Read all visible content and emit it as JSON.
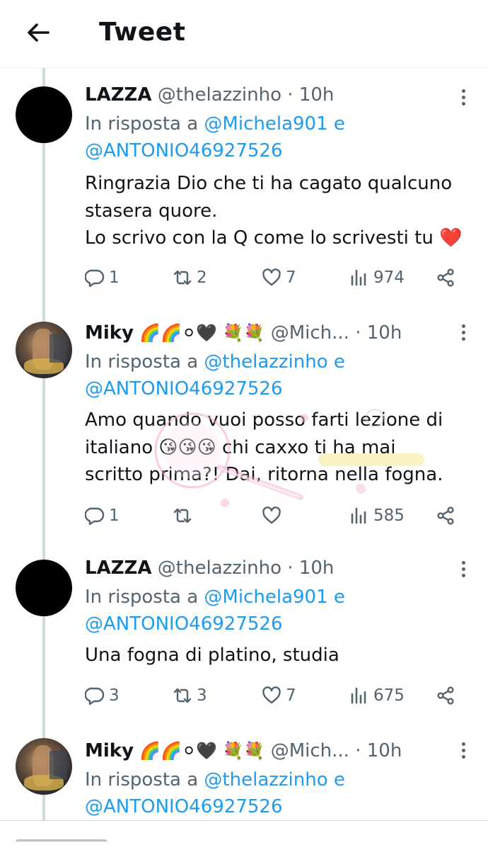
{
  "header": {
    "title": "Tweet",
    "back_icon": "arrow-left-icon"
  },
  "tweets": [
    {
      "name": "LAZZA",
      "handle": "@thelazzinho",
      "separator": "·",
      "time": "10h",
      "reply_prefix": "In risposta a",
      "reply_mention_1": "@Michela901",
      "reply_and": "e",
      "reply_mention_2": "@ANTONIO46927526",
      "lines": [
        "Ringrazia Dio che ti ha cagato qualcuno",
        "stasera quore.",
        "Lo scrivo con la Q come lo scrivesti tu ❤️"
      ],
      "replies": "1",
      "retweets": "2",
      "likes": "7",
      "views": "974"
    },
    {
      "name": "Miky",
      "emojis": "🌈🌈⚪🖤 💐💐",
      "handle": "@Mich...",
      "separator": "·",
      "time": "10h",
      "reply_prefix": "In risposta a",
      "reply_mention_1": "@thelazzinho",
      "reply_and": "e",
      "reply_mention_2": "@ANTONIO46927526",
      "lines": [
        "Amo quando vuoi posso farti lezione di",
        "italiano 😘😘😘 chi caxxo ti ha mai",
        "scritto prima?! Dai, ritorna nella fogna."
      ],
      "replies": "1",
      "retweets": "",
      "likes": "",
      "views": "585"
    },
    {
      "name": "LAZZA",
      "handle": "@thelazzinho",
      "separator": "·",
      "time": "10h",
      "reply_prefix": "In risposta a",
      "reply_mention_1": "@Michela901",
      "reply_and": "e",
      "reply_mention_2": "@ANTONIO46927526",
      "lines": [
        "Una fogna di platino, studia"
      ],
      "replies": "3",
      "retweets": "3",
      "likes": "7",
      "views": "675"
    },
    {
      "name": "Miky",
      "emojis": "🌈🌈⚪🖤 💐💐",
      "handle": "@Mich...",
      "separator": "·",
      "time": "10h",
      "reply_prefix": "In risposta a",
      "reply_mention_1": "@thelazzinho",
      "reply_and": "e",
      "reply_mention_2": "@ANTONIO46927526"
    }
  ],
  "colors": {
    "accent": "#1d9bf0",
    "secondary_text": "#536471",
    "primary_text": "#0f1419",
    "heart": "#e0245e"
  }
}
